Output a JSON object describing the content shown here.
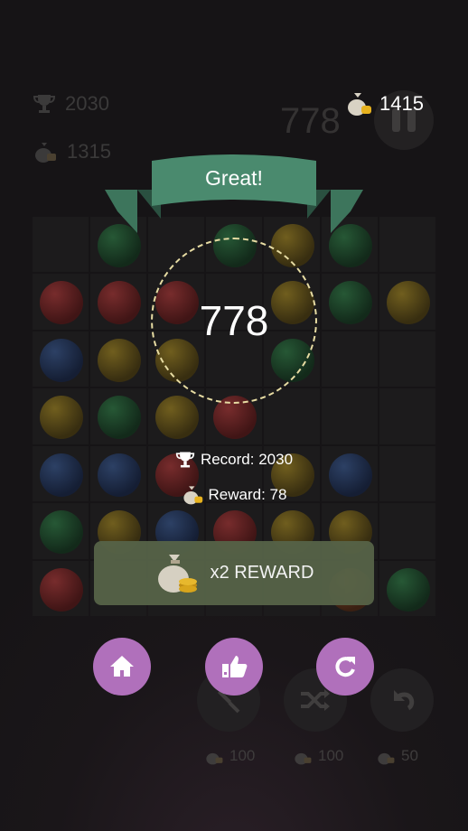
{
  "colors": {
    "background": "#161416",
    "banner": "#4a8a6e",
    "circle_dash": "#e7dca3",
    "reward_button": "#566348",
    "action_button": "#b070bb"
  },
  "hud": {
    "record_value": "2030",
    "coins_value": "1315",
    "coins_balance": "1415",
    "current_score": "778"
  },
  "board": {
    "rows": [
      [
        "",
        "green",
        "",
        "green",
        "yellow",
        "green",
        ""
      ],
      [
        "red",
        "red",
        "red",
        "",
        "yellow",
        "green",
        "yellow"
      ],
      [
        "blue",
        "yellow",
        "yellow",
        "",
        "green",
        "",
        ""
      ],
      [
        "yellow",
        "green",
        "yellow",
        "red",
        "",
        "",
        ""
      ],
      [
        "blue",
        "blue",
        "red",
        "",
        "yellow",
        "blue",
        ""
      ],
      [
        "green",
        "yellow",
        "blue",
        "red",
        "yellow",
        "yellow",
        ""
      ],
      [
        "red",
        "",
        "",
        "",
        "",
        "orange",
        "green"
      ]
    ]
  },
  "tools": [
    {
      "name": "hammer",
      "icon": "hammer-icon",
      "cost": "100"
    },
    {
      "name": "shuffle",
      "icon": "shuffle-icon",
      "cost": "100"
    },
    {
      "name": "undo",
      "icon": "undo-icon",
      "cost": "50"
    }
  ],
  "dialog": {
    "banner_text": "Great!",
    "score": "778",
    "record_text": "Record: 2030",
    "reward_text": "Reward: 78",
    "x2_label": "x2 REWARD",
    "buttons": [
      "home-icon",
      "thumbs-up-icon",
      "restart-icon"
    ]
  }
}
